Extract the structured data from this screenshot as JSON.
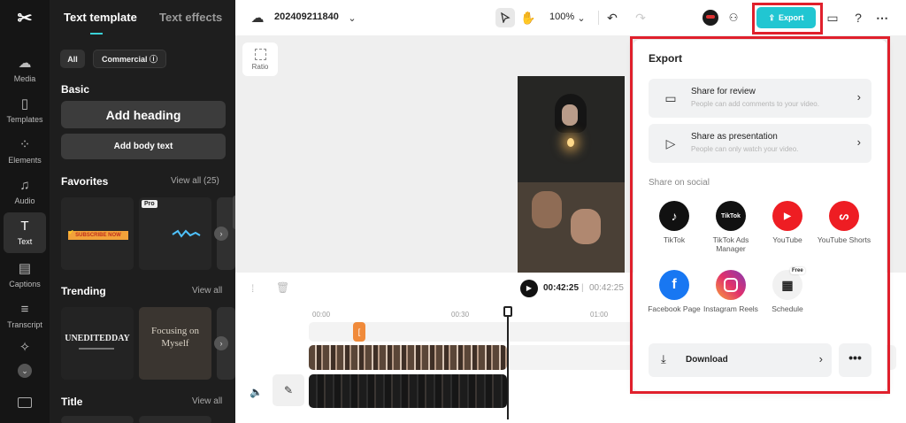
{
  "rail": {
    "items": [
      {
        "label": "Media",
        "icon": "cloud-upload-icon"
      },
      {
        "label": "Templates",
        "icon": "templates-icon"
      },
      {
        "label": "Elements",
        "icon": "elements-icon"
      },
      {
        "label": "Audio",
        "icon": "music-note-icon"
      },
      {
        "label": "Text",
        "icon": "text-icon"
      },
      {
        "label": "Captions",
        "icon": "captions-icon"
      },
      {
        "label": "Transcript",
        "icon": "transcript-icon"
      }
    ]
  },
  "panel": {
    "tabs": [
      "Text template",
      "Text effects"
    ],
    "filters": [
      "All",
      "Commercial ⓘ"
    ],
    "basic": {
      "title": "Basic",
      "add_heading": "Add heading",
      "add_body": "Add body text"
    },
    "favorites": {
      "title": "Favorites",
      "view_all": "View all (25)",
      "card1_text": "SUBSCRIBE NOW",
      "pro_badge": "Pro"
    },
    "trending": {
      "title": "Trending",
      "view_all": "View all",
      "card1_text": "UNEDITEDDAY",
      "card2_text": "Focusing on Myself"
    },
    "title_section": {
      "title": "Title",
      "view_all": "View all"
    }
  },
  "topbar": {
    "project_name": "202409211840",
    "zoom": "100%",
    "export_label": "Export"
  },
  "canvas": {
    "ratio_label": "Ratio"
  },
  "player": {
    "current_time": "00:42:25",
    "separator": "|",
    "total_time": "00:42:25"
  },
  "timeline": {
    "ticks": [
      "00:00",
      "00:30",
      "01:00"
    ]
  },
  "export_dialog": {
    "title": "Export",
    "share_review": {
      "title": "Share for review",
      "subtitle": "People can add comments to your video."
    },
    "share_presentation": {
      "title": "Share as presentation",
      "subtitle": "People can only watch your video."
    },
    "social_label": "Share on social",
    "socials": [
      {
        "name": "TikTok",
        "color": "#111111"
      },
      {
        "name": "TikTok Ads Manager",
        "color": "#111111"
      },
      {
        "name": "YouTube",
        "color": "#ee1d23"
      },
      {
        "name": "YouTube Shorts",
        "color": "#ee1d23"
      },
      {
        "name": "Facebook Page",
        "color": "#1877f2"
      },
      {
        "name": "Instagram Reels",
        "color": "#d62976"
      },
      {
        "name": "Schedule",
        "color": "#f1f1f1"
      }
    ],
    "free_badge": "Free",
    "download_label": "Download",
    "more_label": "•••"
  },
  "colors": {
    "accent": "#21c6d2",
    "highlight": "#e0202c"
  }
}
